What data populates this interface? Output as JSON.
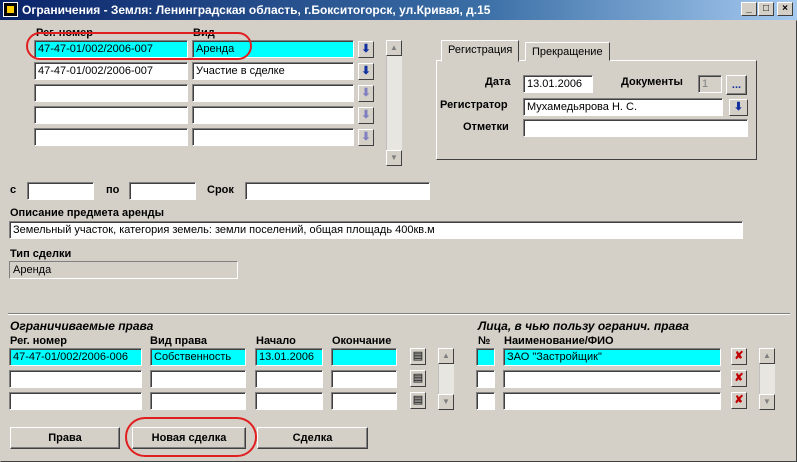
{
  "window": {
    "title": "Ограничения - Земля: Ленинградская область, г.Бокситогорск, ул.Кривая, д.15",
    "min_label": "_",
    "max_label": "□",
    "close_label": "×"
  },
  "deals": {
    "col_reg": "Рег. номер",
    "col_kind": "Вид",
    "rows": [
      {
        "reg": "47-47-01/002/2006-007",
        "kind": "Аренда"
      },
      {
        "reg": "47-47-01/002/2006-007",
        "kind": "Участие в сделке"
      },
      {
        "reg": "",
        "kind": ""
      },
      {
        "reg": "",
        "kind": ""
      },
      {
        "reg": "",
        "kind": ""
      }
    ],
    "lookup_glyph": "⬇"
  },
  "tabs": {
    "registration": "Регистрация",
    "termination": "Прекращение"
  },
  "registration": {
    "date_label": "Дата",
    "date_value": "13.01.2006",
    "docs_label": "Документы",
    "docs_value": "1",
    "docs_button": "...",
    "registrar_label": "Регистратор",
    "registrar_value": "Мухамедьярова Н. С.",
    "notes_label": "Отметки",
    "notes_value": ""
  },
  "period": {
    "from_label": "с",
    "from_value": "",
    "to_label": "по",
    "to_value": "",
    "term_label": "Срок",
    "term_value": ""
  },
  "subject": {
    "label": "Описание предмета аренды",
    "value": "Земельный участок, категория земель: земли поселений, общая площадь 400кв.м"
  },
  "deal_type": {
    "label": "Тип сделки",
    "value": "Аренда"
  },
  "restricted_rights": {
    "heading": "Ограничиваемые права",
    "col_reg": "Рег. номер",
    "col_kind": "Вид права",
    "col_start": "Начало",
    "col_end": "Окончание",
    "rows": [
      {
        "reg": "47-47-01/002/2006-006",
        "kind": "Собственность",
        "start": "13.01.2006",
        "end": ""
      },
      {
        "reg": "",
        "kind": "",
        "start": "",
        "end": ""
      },
      {
        "reg": "",
        "kind": "",
        "start": "",
        "end": ""
      }
    ]
  },
  "beneficiaries": {
    "heading": "Лица, в чью пользу огранич. права",
    "col_num": "№",
    "col_name": "Наименование/ФИО",
    "rows": [
      {
        "num": "",
        "name": "ЗАО \"Застройщик\""
      },
      {
        "num": "",
        "name": ""
      },
      {
        "num": "",
        "name": ""
      }
    ],
    "remove_glyph": "✘"
  },
  "buttons": {
    "rights": "Права",
    "new_deal": "Новая сделка",
    "deal": "Сделка"
  }
}
